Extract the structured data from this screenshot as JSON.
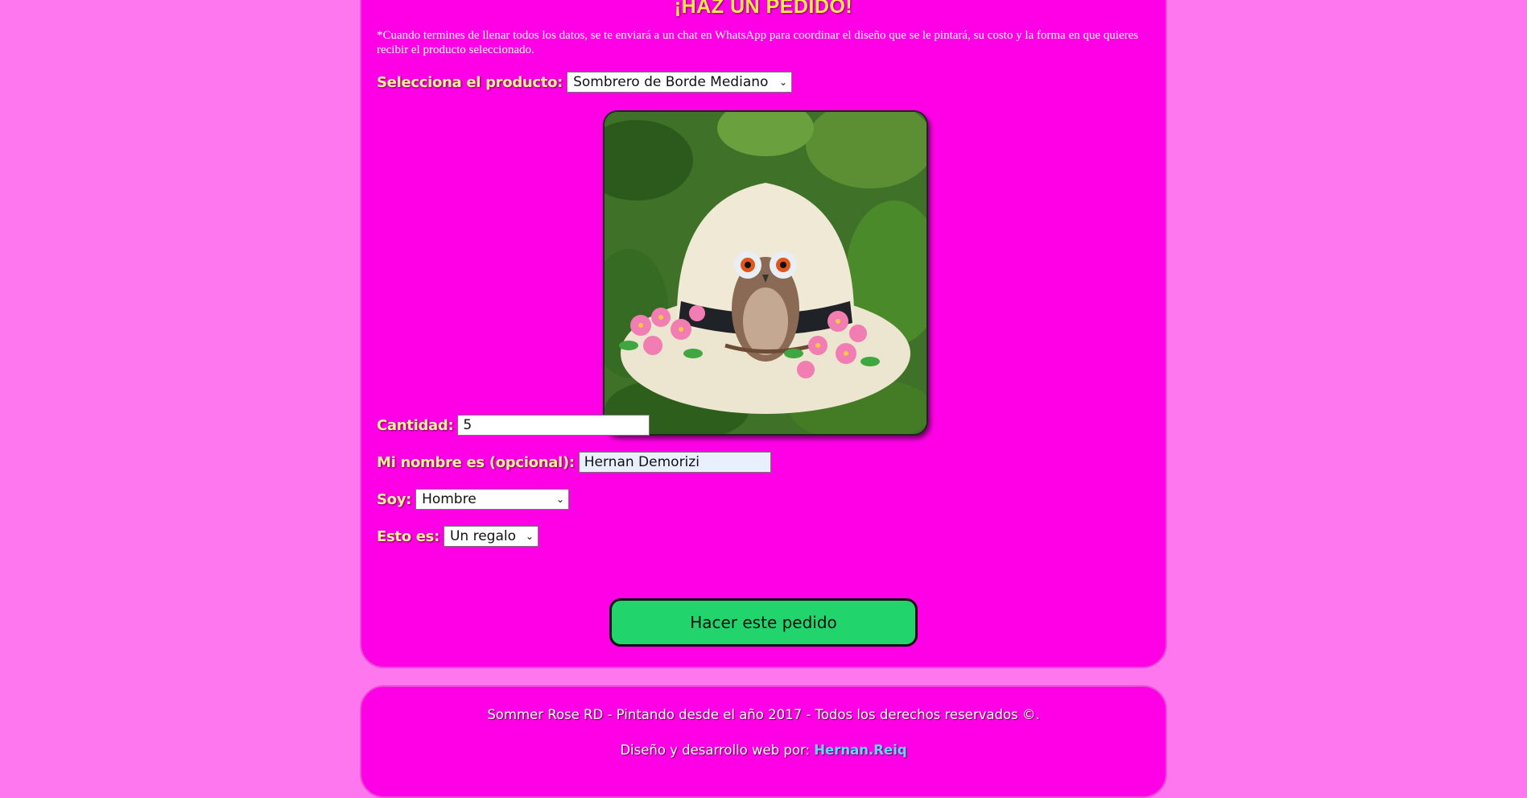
{
  "order": {
    "heading": "¡HAZ UN PEDIDO!",
    "note": "*Cuando termines de llenar todos los datos, se te enviará a un chat en WhatsApp para coordinar el diseño que se le pintará, su costo y la forma en que quieres recibir el producto seleccionado.",
    "product_label": "Selecciona el producto:",
    "product_value": "Sombrero de Borde Mediano",
    "quantity_label": "Cantidad:",
    "quantity_value": "5",
    "name_label": "Mi nombre es (opcional):",
    "name_value": "Hernan Demorizi",
    "gender_label": "Soy:",
    "gender_value": "Hombre",
    "purpose_label": "Esto es:",
    "purpose_value": "Un regalo",
    "submit_label": "Hacer este pedido"
  },
  "footer": {
    "copyright": "Sommer Rose RD - Pintando desde el año 2017 - Todos los derechos reservados ©.",
    "credit_prefix": "Diseño y desarrollo web por: ",
    "credit_link": "Hernan.Reiq"
  },
  "colors": {
    "panel": "#ff00e6",
    "page_background": "#ff77ee",
    "label": "#ffee99",
    "button": "#22d46c",
    "link": "#5fd9ff"
  }
}
